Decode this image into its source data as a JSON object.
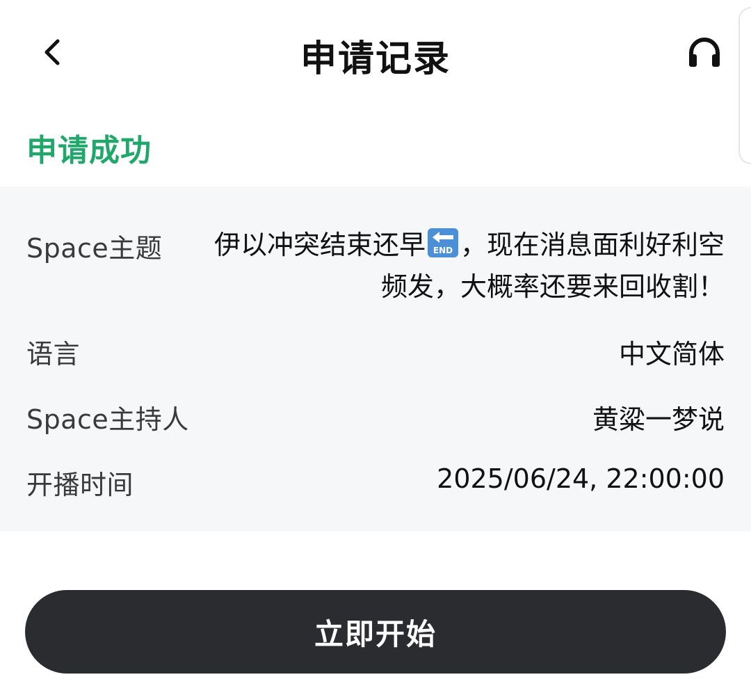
{
  "header": {
    "title": "申请记录",
    "back_icon": "chevron-left-icon",
    "support_icon": "headphones-icon"
  },
  "status": {
    "text": "申请成功",
    "color": "#20a86b"
  },
  "details": {
    "topic": {
      "label": "Space主题",
      "value_part1": "伊以冲突结束还早",
      "value_emoji": "END",
      "value_part2": "，现在消息面利好利空频发，大概率还要来回收割！"
    },
    "language": {
      "label": "语言",
      "value": "中文简体"
    },
    "host": {
      "label": "Space主持人",
      "value": "黄粱一梦说"
    },
    "start_time": {
      "label": "开播时间",
      "value": "2025/06/24, 22:00:00"
    }
  },
  "actions": {
    "start_label": "立即开始"
  }
}
